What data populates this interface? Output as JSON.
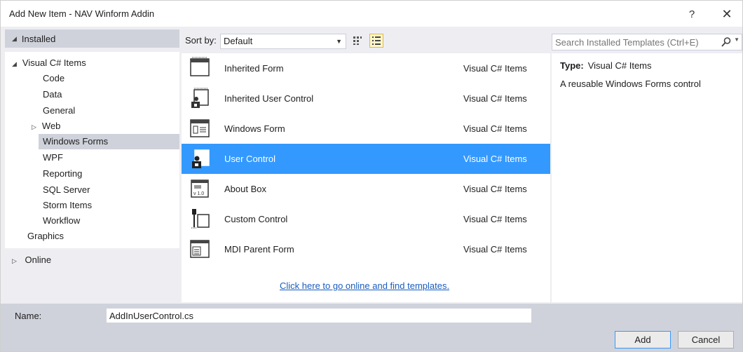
{
  "window": {
    "title": "Add New Item - NAV Winform Addin",
    "help_label": "?",
    "close_label": "✕"
  },
  "left": {
    "installed_label": "Installed",
    "tree": [
      {
        "label": "Visual C# Items",
        "expanded": true
      },
      {
        "label": "Code"
      },
      {
        "label": "Data"
      },
      {
        "label": "General"
      },
      {
        "label": "Web",
        "collapsed": true
      },
      {
        "label": "Windows Forms",
        "selected": true
      },
      {
        "label": "WPF"
      },
      {
        "label": "Reporting"
      },
      {
        "label": "SQL Server"
      },
      {
        "label": "Storm Items"
      },
      {
        "label": "Workflow"
      },
      {
        "label": "Graphics"
      }
    ],
    "online_label": "Online"
  },
  "toolbar": {
    "sort_label": "Sort by:",
    "sort_value": "Default"
  },
  "templates": [
    {
      "name": "Inherited Form",
      "category": "Visual C# Items",
      "icon": "inherited-form-icon"
    },
    {
      "name": "Inherited User Control",
      "category": "Visual C# Items",
      "icon": "inherited-user-control-icon"
    },
    {
      "name": "Windows Form",
      "category": "Visual C# Items",
      "icon": "windows-form-icon"
    },
    {
      "name": "User Control",
      "category": "Visual C# Items",
      "icon": "user-control-icon",
      "selected": true
    },
    {
      "name": "About Box",
      "category": "Visual C# Items",
      "icon": "about-box-icon"
    },
    {
      "name": "Custom Control",
      "category": "Visual C# Items",
      "icon": "custom-control-icon"
    },
    {
      "name": "MDI Parent Form",
      "category": "Visual C# Items",
      "icon": "mdi-parent-form-icon"
    }
  ],
  "online_link": "Click here to go online and find templates.",
  "search": {
    "placeholder": "Search Installed Templates (Ctrl+E)"
  },
  "details": {
    "type_label": "Type:",
    "type_value": "Visual C# Items",
    "description": "A reusable Windows Forms control"
  },
  "bottom": {
    "name_label": "Name:",
    "name_value": "AddInUserControl.cs",
    "add_label": "Add",
    "cancel_label": "Cancel"
  },
  "colors": {
    "selection": "#3399ff",
    "link": "#1a5dbe",
    "panel": "#cfd2da"
  }
}
